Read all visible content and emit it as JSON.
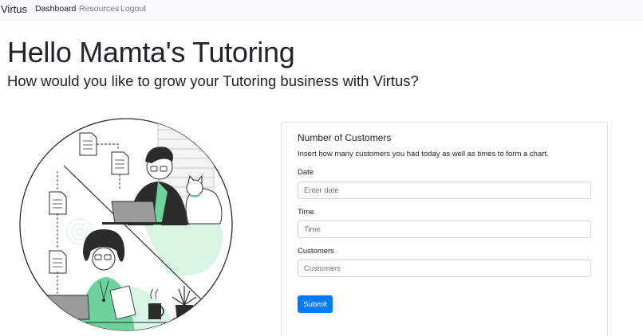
{
  "navbar": {
    "brand": "Virtus",
    "links": [
      {
        "label": "Dashboard",
        "active": true
      },
      {
        "label": "Resources",
        "active": false
      },
      {
        "label": "Logout",
        "active": false
      }
    ]
  },
  "hero": {
    "title": "Hello Mamta's Tutoring",
    "subtitle": "How would you like to grow your Tutoring business with Virtus?"
  },
  "illustration": {
    "icon": "people-working-illustration",
    "accent_color": "#c9f0d8"
  },
  "card": {
    "title": "Number of Customers",
    "description": "Insert how many customers you had today as well as times to form a chart.",
    "fields": [
      {
        "label": "Date",
        "placeholder": "Enter date",
        "value": ""
      },
      {
        "label": "Time",
        "placeholder": "Time",
        "value": ""
      },
      {
        "label": "Customers",
        "placeholder": "Customers",
        "value": ""
      }
    ],
    "submit_label": "Submit"
  },
  "colors": {
    "primary": "#007bff",
    "navbar_bg": "#f8f9fa",
    "text": "#212529"
  }
}
